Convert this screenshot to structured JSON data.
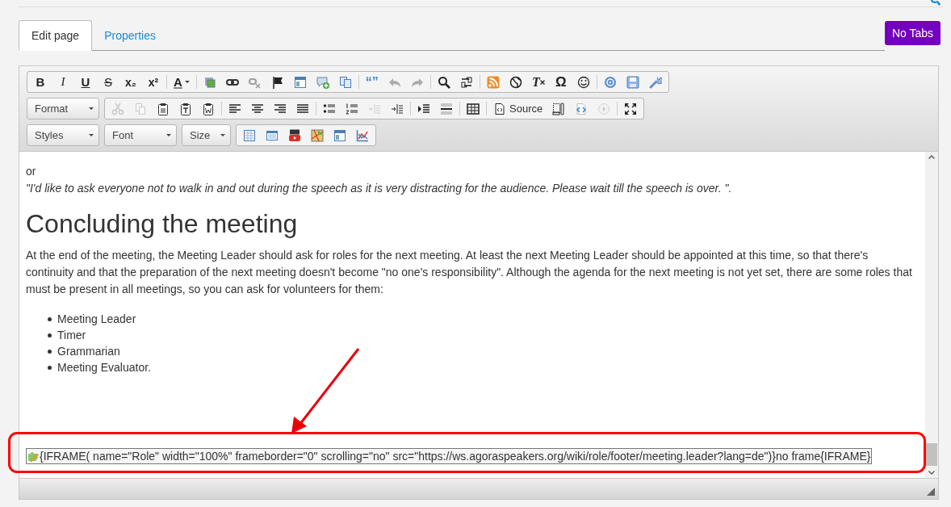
{
  "tabs": [
    {
      "label": "Edit page",
      "selected": true
    },
    {
      "label": "Properties",
      "selected": false
    }
  ],
  "no_tabs_button": "No Tabs",
  "toolbar": {
    "rows": [
      {
        "items": [
          {
            "kind": "box",
            "groups": [
              [
                {
                  "glyph": "B",
                  "disabled": false
                },
                {
                  "glyph": "I",
                  "disabled": false
                },
                {
                  "glyph": "U",
                  "disabled": false
                },
                {
                  "glyph": "S",
                  "disabled": false
                },
                {
                  "glyph": "x₂",
                  "disabled": false
                },
                {
                  "glyph": "x²",
                  "disabled": false
                }
              ],
              [
                {
                  "glyph": "A",
                  "disabled": false
                }
              ],
              [
                {
                  "disabled": false
                },
                {
                  "disabled": false
                },
                {
                  "disabled": true
                },
                {
                  "disabled": false
                },
                {
                  "disabled": false
                },
                {
                  "disabled": false
                },
                {
                  "disabled": false
                }
              ],
              [
                {
                  "glyph": "“”",
                  "disabled": false
                },
                {
                  "disabled": true
                },
                {
                  "disabled": true
                }
              ],
              [
                {
                  "disabled": false
                },
                {
                  "disabled": false
                }
              ],
              [
                {
                  "disabled": false
                },
                {
                  "disabled": false
                },
                {
                  "glyph": "T",
                  "disabled": false
                },
                {
                  "glyph": "Ω",
                  "disabled": false
                },
                {
                  "disabled": false
                }
              ],
              [
                {
                  "disabled": false
                },
                {
                  "disabled": false
                },
                {
                  "disabled": false
                }
              ]
            ]
          }
        ]
      },
      {
        "items": [
          {
            "kind": "dropdown",
            "label": "Format"
          },
          {
            "kind": "box",
            "groups": [
              [
                {
                  "disabled": true
                },
                {
                  "disabled": true
                },
                {
                  "disabled": false
                },
                {
                  "disabled": false
                },
                {
                  "disabled": false
                }
              ],
              [
                {
                  "disabled": false
                },
                {
                  "disabled": false
                },
                {
                  "disabled": false
                },
                {
                  "disabled": false
                }
              ],
              [
                {
                  "disabled": false
                },
                {
                  "disabled": false
                },
                {
                  "disabled": true
                },
                {
                  "disabled": false
                }
              ],
              [
                {
                  "disabled": false
                },
                {
                  "disabled": false
                }
              ],
              [
                {
                  "disabled": false
                }
              ],
              [
                {
                  "label": "Source",
                  "disabled": false
                },
                {
                  "disabled": false
                },
                {
                  "disabled": false
                },
                {
                  "disabled": true
                }
              ],
              [
                {
                  "disabled": false
                }
              ]
            ]
          }
        ]
      },
      {
        "items": [
          {
            "kind": "dropdown",
            "label": "Styles"
          },
          {
            "kind": "dropdown",
            "label": "Font"
          },
          {
            "kind": "dropdown",
            "label": "Size"
          },
          {
            "kind": "box",
            "groups": [
              [
                {
                  "disabled": false
                },
                {
                  "disabled": false
                },
                {
                  "disabled": false
                },
                {
                  "disabled": false
                },
                {
                  "disabled": false
                },
                {
                  "disabled": false
                }
              ]
            ]
          }
        ]
      }
    ]
  },
  "content": {
    "intro": "or",
    "quote": "\"I'd like to ask everyone not to walk in and out during the speech as it is very distracting for the audience. Please wait till the speech is over. \".",
    "heading": "Concluding the meeting",
    "paragraph": "At the end of the meeting, the Meeting Leader should ask for roles for the next meeting. At least the next Meeting Leader should be appointed at this time, so that there's continuity and that the preparation of the next meeting doesn't become \"no one's responsibility\". Although the agenda for the next meeting is not yet set, there are some roles that must be present in all meetings, so you can ask for volunteers for them:",
    "list": [
      "Meeting Leader",
      "Timer",
      "Grammarian",
      "Meeting Evaluator."
    ],
    "plugin_code": "{IFRAME( name=\"Role\" width=\"100%\" frameborder=\"0\" scrolling=\"no\" src=\"https://ws.agoraspeakers.org/wiki/role/footer/meeting.leader?lang=de\")}no frame{IFRAME}"
  }
}
